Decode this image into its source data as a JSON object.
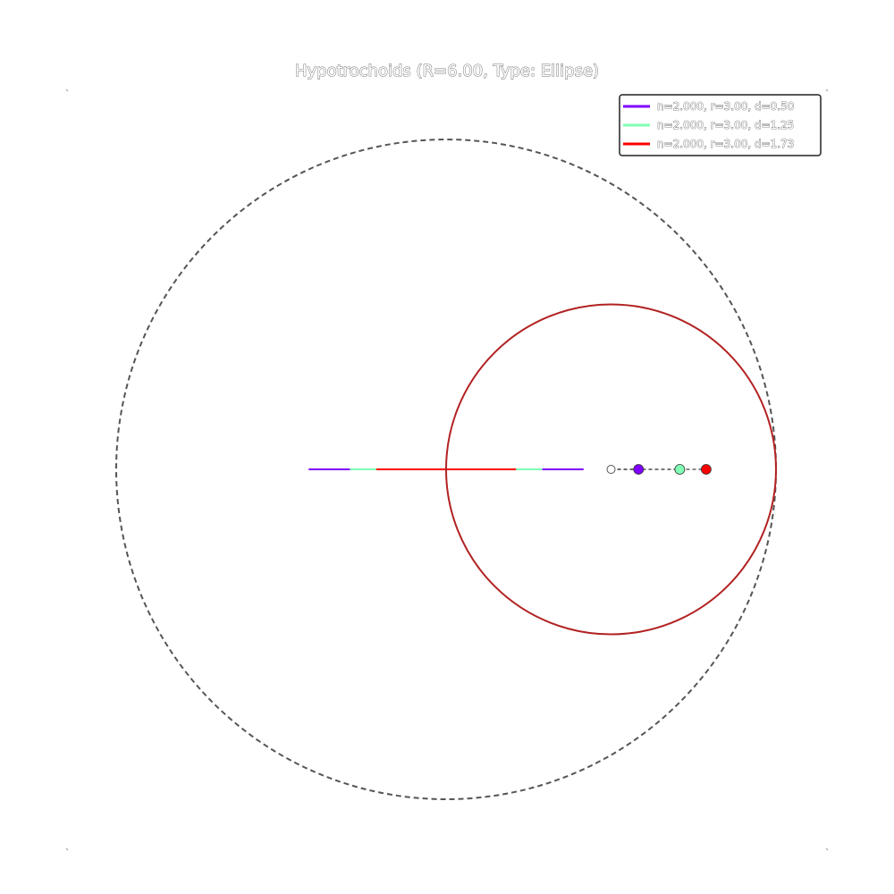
{
  "chart_data": {
    "type": "line",
    "title": "Hypotrochoids (R=6.00, Type: Ellipse)",
    "xlabel": "",
    "ylabel": "",
    "xlim": [
      -7.2,
      7.2
    ],
    "ylim": [
      -7.2,
      7.2
    ],
    "grid": false,
    "legend_position": "top-right",
    "fixed_circle": {
      "radius": 6,
      "center": [
        0,
        0
      ],
      "style": "dashed",
      "color": "#555555"
    },
    "rolling_circle": {
      "radius": 3,
      "center": [
        3,
        0
      ],
      "color": "#b22222"
    },
    "rolling_center_marker": {
      "x": 3,
      "y": 0,
      "color": "#ffffff"
    },
    "series": [
      {
        "name": "n=2.000, r=3.00, d=0.50",
        "color": "#7f00ff",
        "n": 2.0,
        "r": 3.0,
        "d": 0.5,
        "curve": {
          "x": [
            -2.5,
            2.5
          ],
          "y": [
            0,
            0
          ]
        },
        "marker": {
          "x": 3.5,
          "y": 0
        }
      },
      {
        "name": "n=2.000, r=3.00, d=1.25",
        "color": "#80ffb4",
        "n": 2.0,
        "r": 3.0,
        "d": 1.25,
        "curve": {
          "x": [
            -1.75,
            1.75
          ],
          "y": [
            0,
            0
          ]
        },
        "marker": {
          "x": 4.25,
          "y": 0
        }
      },
      {
        "name": "n=2.000, r=3.00, d=1.73",
        "color": "#ff0000",
        "n": 2.0,
        "r": 3.0,
        "d": 1.73,
        "curve": {
          "x": [
            -1.27,
            1.27
          ],
          "y": [
            0,
            0
          ]
        },
        "marker": {
          "x": 4.73,
          "y": 0
        }
      }
    ]
  }
}
